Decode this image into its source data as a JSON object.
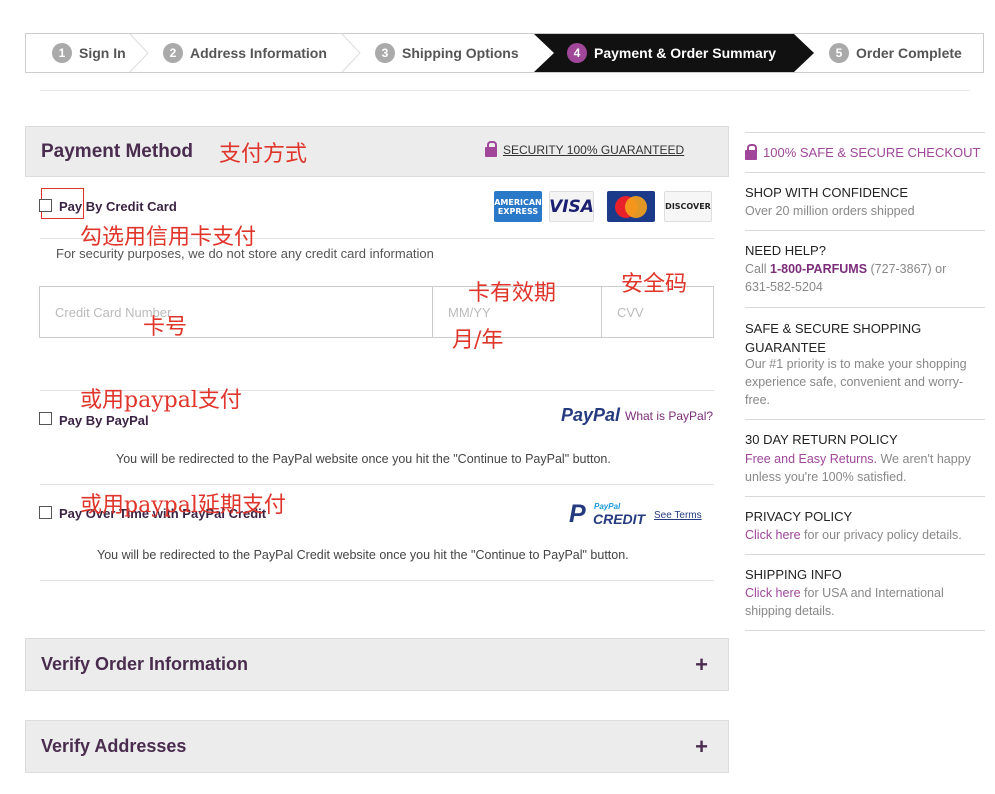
{
  "steps": [
    {
      "num": "1",
      "label": "Sign In"
    },
    {
      "num": "2",
      "label": "Address Information"
    },
    {
      "num": "3",
      "label": "Shipping Options"
    },
    {
      "num": "4",
      "label": "Payment & Order Summary"
    },
    {
      "num": "5",
      "label": "Order Complete"
    }
  ],
  "payment": {
    "title": "Payment Method",
    "security": "SECURITY 100% GUARANTEED",
    "credit": {
      "label": "Pay By Credit Card",
      "note": "For security purposes, we do not store any credit card information",
      "card_number_placeholder": "Credit Card Number",
      "expiry_placeholder": "MM/YY",
      "cvv_placeholder": "CVV",
      "cards": [
        "AMERICAN EXPRESS",
        "VISA",
        "MasterCard",
        "DISCOVER"
      ]
    },
    "paypal": {
      "label": "Pay By PayPal",
      "logo": "PayPal",
      "what_link": "What is PayPal?",
      "note": "You will be redirected to the PayPal website once you hit the \"Continue to PayPal\" button."
    },
    "paypal_credit": {
      "label": "Pay Over Time with PayPal Credit",
      "logo_top": "PayPal",
      "logo_bottom": "CREDIT",
      "terms_link": "See Terms",
      "note": "You will be redirected to the PayPal Credit website once you hit the \"Continue to PayPal\" button."
    }
  },
  "annotations": {
    "payment_method": "支付方式",
    "check_credit": "勾选用信用卡支付",
    "card_number": "卡号",
    "expiry": "卡有效期",
    "month_year": "月/年",
    "cvv": "安全码",
    "or_paypal": "或用paypal支付",
    "or_paypal_credit": "或用paypal延期支付"
  },
  "panels": {
    "verify_order": "Verify Order Information",
    "verify_addresses": "Verify Addresses",
    "expand": "+"
  },
  "sidebar": {
    "safe_checkout": "100% SAFE & SECURE CHECKOUT",
    "confidence_title": "SHOP WITH CONFIDENCE",
    "confidence_text": "Over 20 million orders shipped",
    "help_title": "NEED HELP?",
    "help_call": "Call ",
    "help_phone": "1-800-PARFUMS",
    "help_rest": " (727-3867) or",
    "help_phone2": "631-582-5204",
    "secure_title_1": "SAFE & SECURE SHOPPING",
    "secure_title_2": "GUARANTEE",
    "secure_text": "Our #1 priority is to make your shopping experience safe, convenient and worry-free.",
    "return_title": "30 DAY RETURN POLICY",
    "return_link": "Free and Easy Returns.",
    "return_text": " We aren't happy unless you're 100% satisfied.",
    "privacy_title": "PRIVACY POLICY",
    "privacy_link": "Click here",
    "privacy_text": " for our privacy policy details.",
    "shipping_title": "SHIPPING INFO",
    "shipping_link": "Click here",
    "shipping_text": " for USA and International shipping details."
  },
  "colors": {
    "accent": "#a0479a",
    "dark": "#4a2c4f",
    "annotation": "#e0352b"
  }
}
